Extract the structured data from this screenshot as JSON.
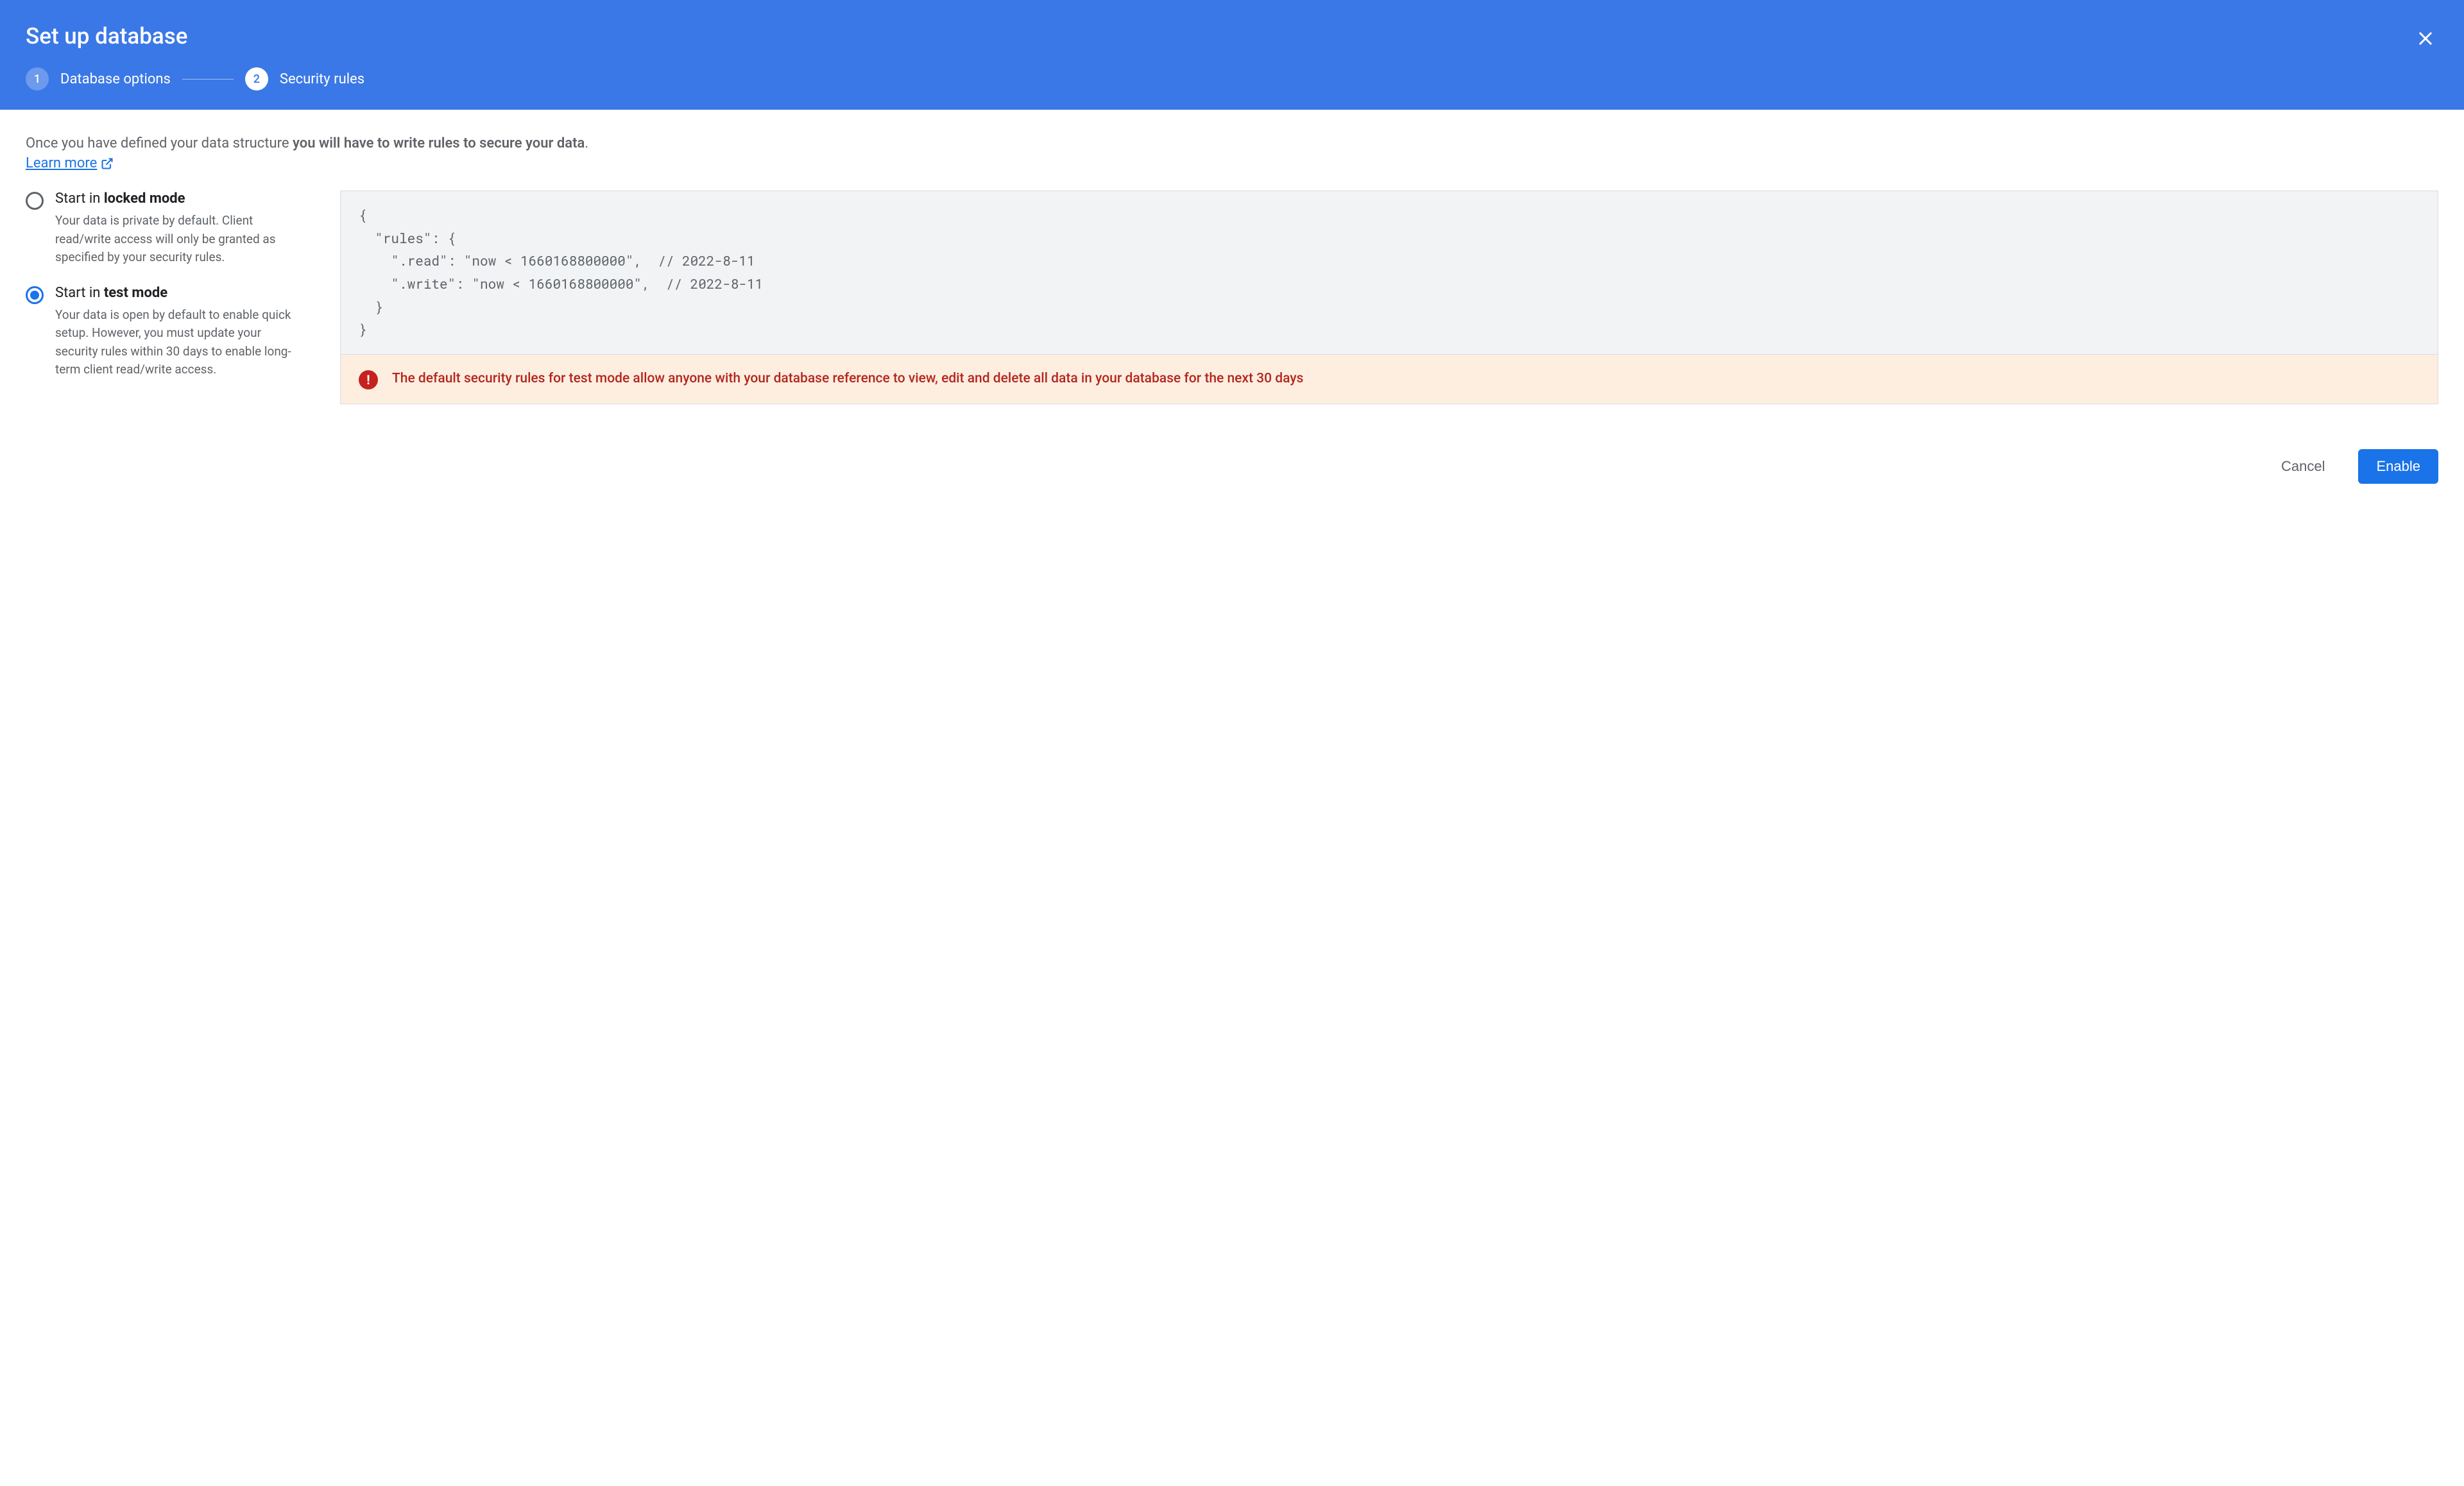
{
  "header": {
    "title": "Set up database",
    "steps": [
      {
        "num": "1",
        "label": "Database options",
        "active": false
      },
      {
        "num": "2",
        "label": "Security rules",
        "active": true
      }
    ]
  },
  "intro": {
    "prefix": "Once you have defined your data structure ",
    "bold": "you will have to write rules to secure your data",
    "suffix": ".",
    "learn_more": "Learn more"
  },
  "options": [
    {
      "id": "locked",
      "title_prefix": "Start in ",
      "title_bold": "locked mode",
      "desc": "Your data is private by default. Client read/write access will only be granted as specified by your security rules.",
      "selected": false
    },
    {
      "id": "test",
      "title_prefix": "Start in ",
      "title_bold": "test mode",
      "desc": "Your data is open by default to enable quick setup. However, you must update your security rules within 30 days to enable long-term client read/write access.",
      "selected": true
    }
  ],
  "code": "{\n  \"rules\": {\n    \".read\": \"now < 1660168800000\",  // 2022-8-11\n    \".write\": \"now < 1660168800000\",  // 2022-8-11\n  }\n}",
  "warning": "The default security rules for test mode allow anyone with your database reference to view, edit and delete all data in your database for the next 30 days",
  "footer": {
    "cancel": "Cancel",
    "enable": "Enable"
  }
}
